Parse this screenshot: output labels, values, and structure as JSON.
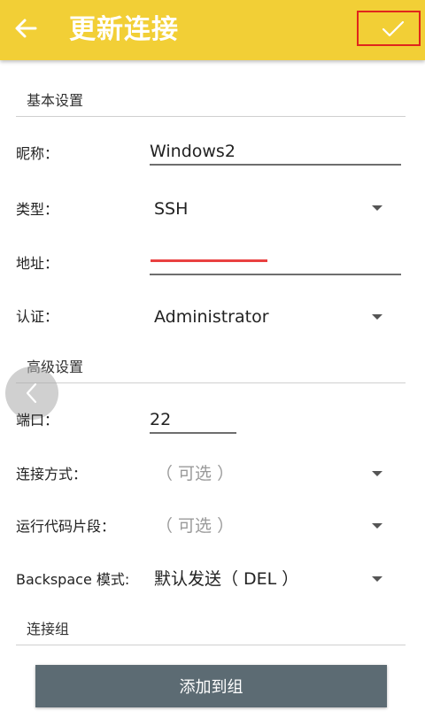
{
  "appbar": {
    "title": "更新连接",
    "back_icon": "arrow-left-icon",
    "confirm_icon": "check-icon",
    "confirm_highlight_color": "#e0261c",
    "background_color": "#f2cf36"
  },
  "sections": {
    "basic": "基本设置",
    "advanced": "高级设置",
    "group": "连接组"
  },
  "basic": {
    "nickname_label": "昵称：",
    "nickname_value": "Windows2",
    "type_label": "类型：",
    "type_value": "SSH",
    "address_label": "地址：",
    "auth_label": "认证：",
    "auth_value": "Administrator"
  },
  "advanced": {
    "port_label": "端口：",
    "port_value": "22",
    "conn_method_label": "连接方式：",
    "conn_method_value": "（ 可选 ）",
    "snippet_label": "运行代码片段：",
    "snippet_value": "（ 可选 ）",
    "backspace_label": "Backspace 模式:",
    "backspace_value": "默认发送（ DEL ）"
  },
  "footer": {
    "add_group_label": "添加到组"
  }
}
